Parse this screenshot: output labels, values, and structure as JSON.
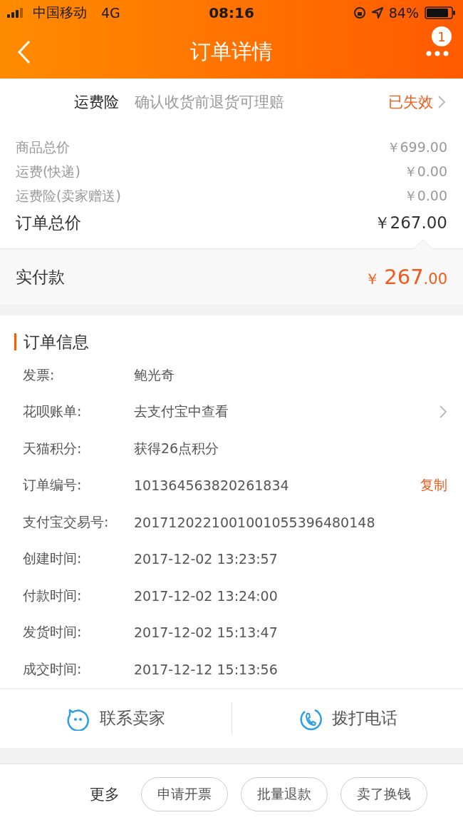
{
  "status_bar": {
    "carrier": "中国移动",
    "network": "4G",
    "time": "08:16",
    "battery": "84%"
  },
  "nav": {
    "title": "订单详情",
    "badge": "1"
  },
  "insurance": {
    "label": "运费险",
    "description": "确认收货前退货可理赔",
    "status": "已失效"
  },
  "prices": [
    {
      "label": "商品总价",
      "value": "￥699.00",
      "kind": "minor"
    },
    {
      "label": "运费(快递)",
      "value": "￥0.00",
      "kind": "minor"
    },
    {
      "label": "运费险(卖家赠送)",
      "value": "￥0.00",
      "kind": "minor"
    },
    {
      "label": "订单总价",
      "value": "￥267.00",
      "kind": "total"
    }
  ],
  "paid": {
    "label": "实付款",
    "currency": "￥",
    "integer": "267",
    "decimal": ".00"
  },
  "order_info": {
    "title": "订单信息",
    "rows": [
      {
        "label": "发票:",
        "value": "鲍光奇",
        "kind": "plain"
      },
      {
        "label": "花呗账单:",
        "value": "去支付宝中查看",
        "kind": "arrow"
      },
      {
        "label": "天猫积分:",
        "value": "获得26点积分",
        "kind": "plain"
      },
      {
        "label": "订单编号:",
        "value": "101364563820261834",
        "kind": "copy",
        "action": "复制"
      },
      {
        "label": "支付宝交易号:",
        "value": "2017120221001001055396480148",
        "kind": "plain"
      },
      {
        "label": "创建时间:",
        "value": "2017-12-02 13:23:57",
        "kind": "plain"
      },
      {
        "label": "付款时间:",
        "value": "2017-12-02 13:24:00",
        "kind": "plain"
      },
      {
        "label": "发货时间:",
        "value": "2017-12-02 15:13:47",
        "kind": "plain"
      },
      {
        "label": "成交时间:",
        "value": "2017-12-12 15:13:56",
        "kind": "plain"
      }
    ]
  },
  "contact": [
    {
      "label": "联系卖家",
      "kind": "chat"
    },
    {
      "label": "拨打电话",
      "kind": "phone"
    }
  ],
  "bottom_bar": {
    "more": "更多",
    "buttons": [
      "申请开票",
      "批量退款",
      "卖了换钱"
    ]
  }
}
